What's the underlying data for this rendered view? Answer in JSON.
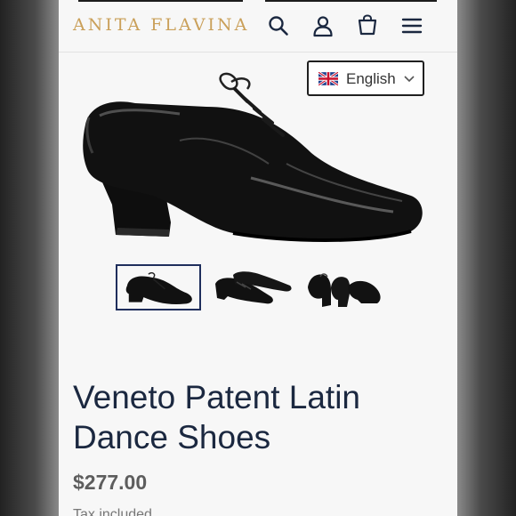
{
  "header": {
    "logo": "ANITA FLAVINA",
    "icons": [
      "search-icon",
      "account-icon",
      "cart-icon",
      "menu-icon"
    ]
  },
  "language_selector": {
    "label": "English",
    "flag": "uk-flag-icon"
  },
  "product": {
    "title": "Veneto Patent Latin Dance Shoes",
    "price": "$277.00",
    "tax_note": "Tax included."
  },
  "thumbnails": [
    {
      "name": "side view",
      "active": true
    },
    {
      "name": "pair view",
      "active": false
    },
    {
      "name": "back view",
      "active": false
    }
  ],
  "colors": {
    "brand": "#caa05a",
    "title": "#1b2840",
    "active_thumb_border": "#1f2e5c"
  }
}
